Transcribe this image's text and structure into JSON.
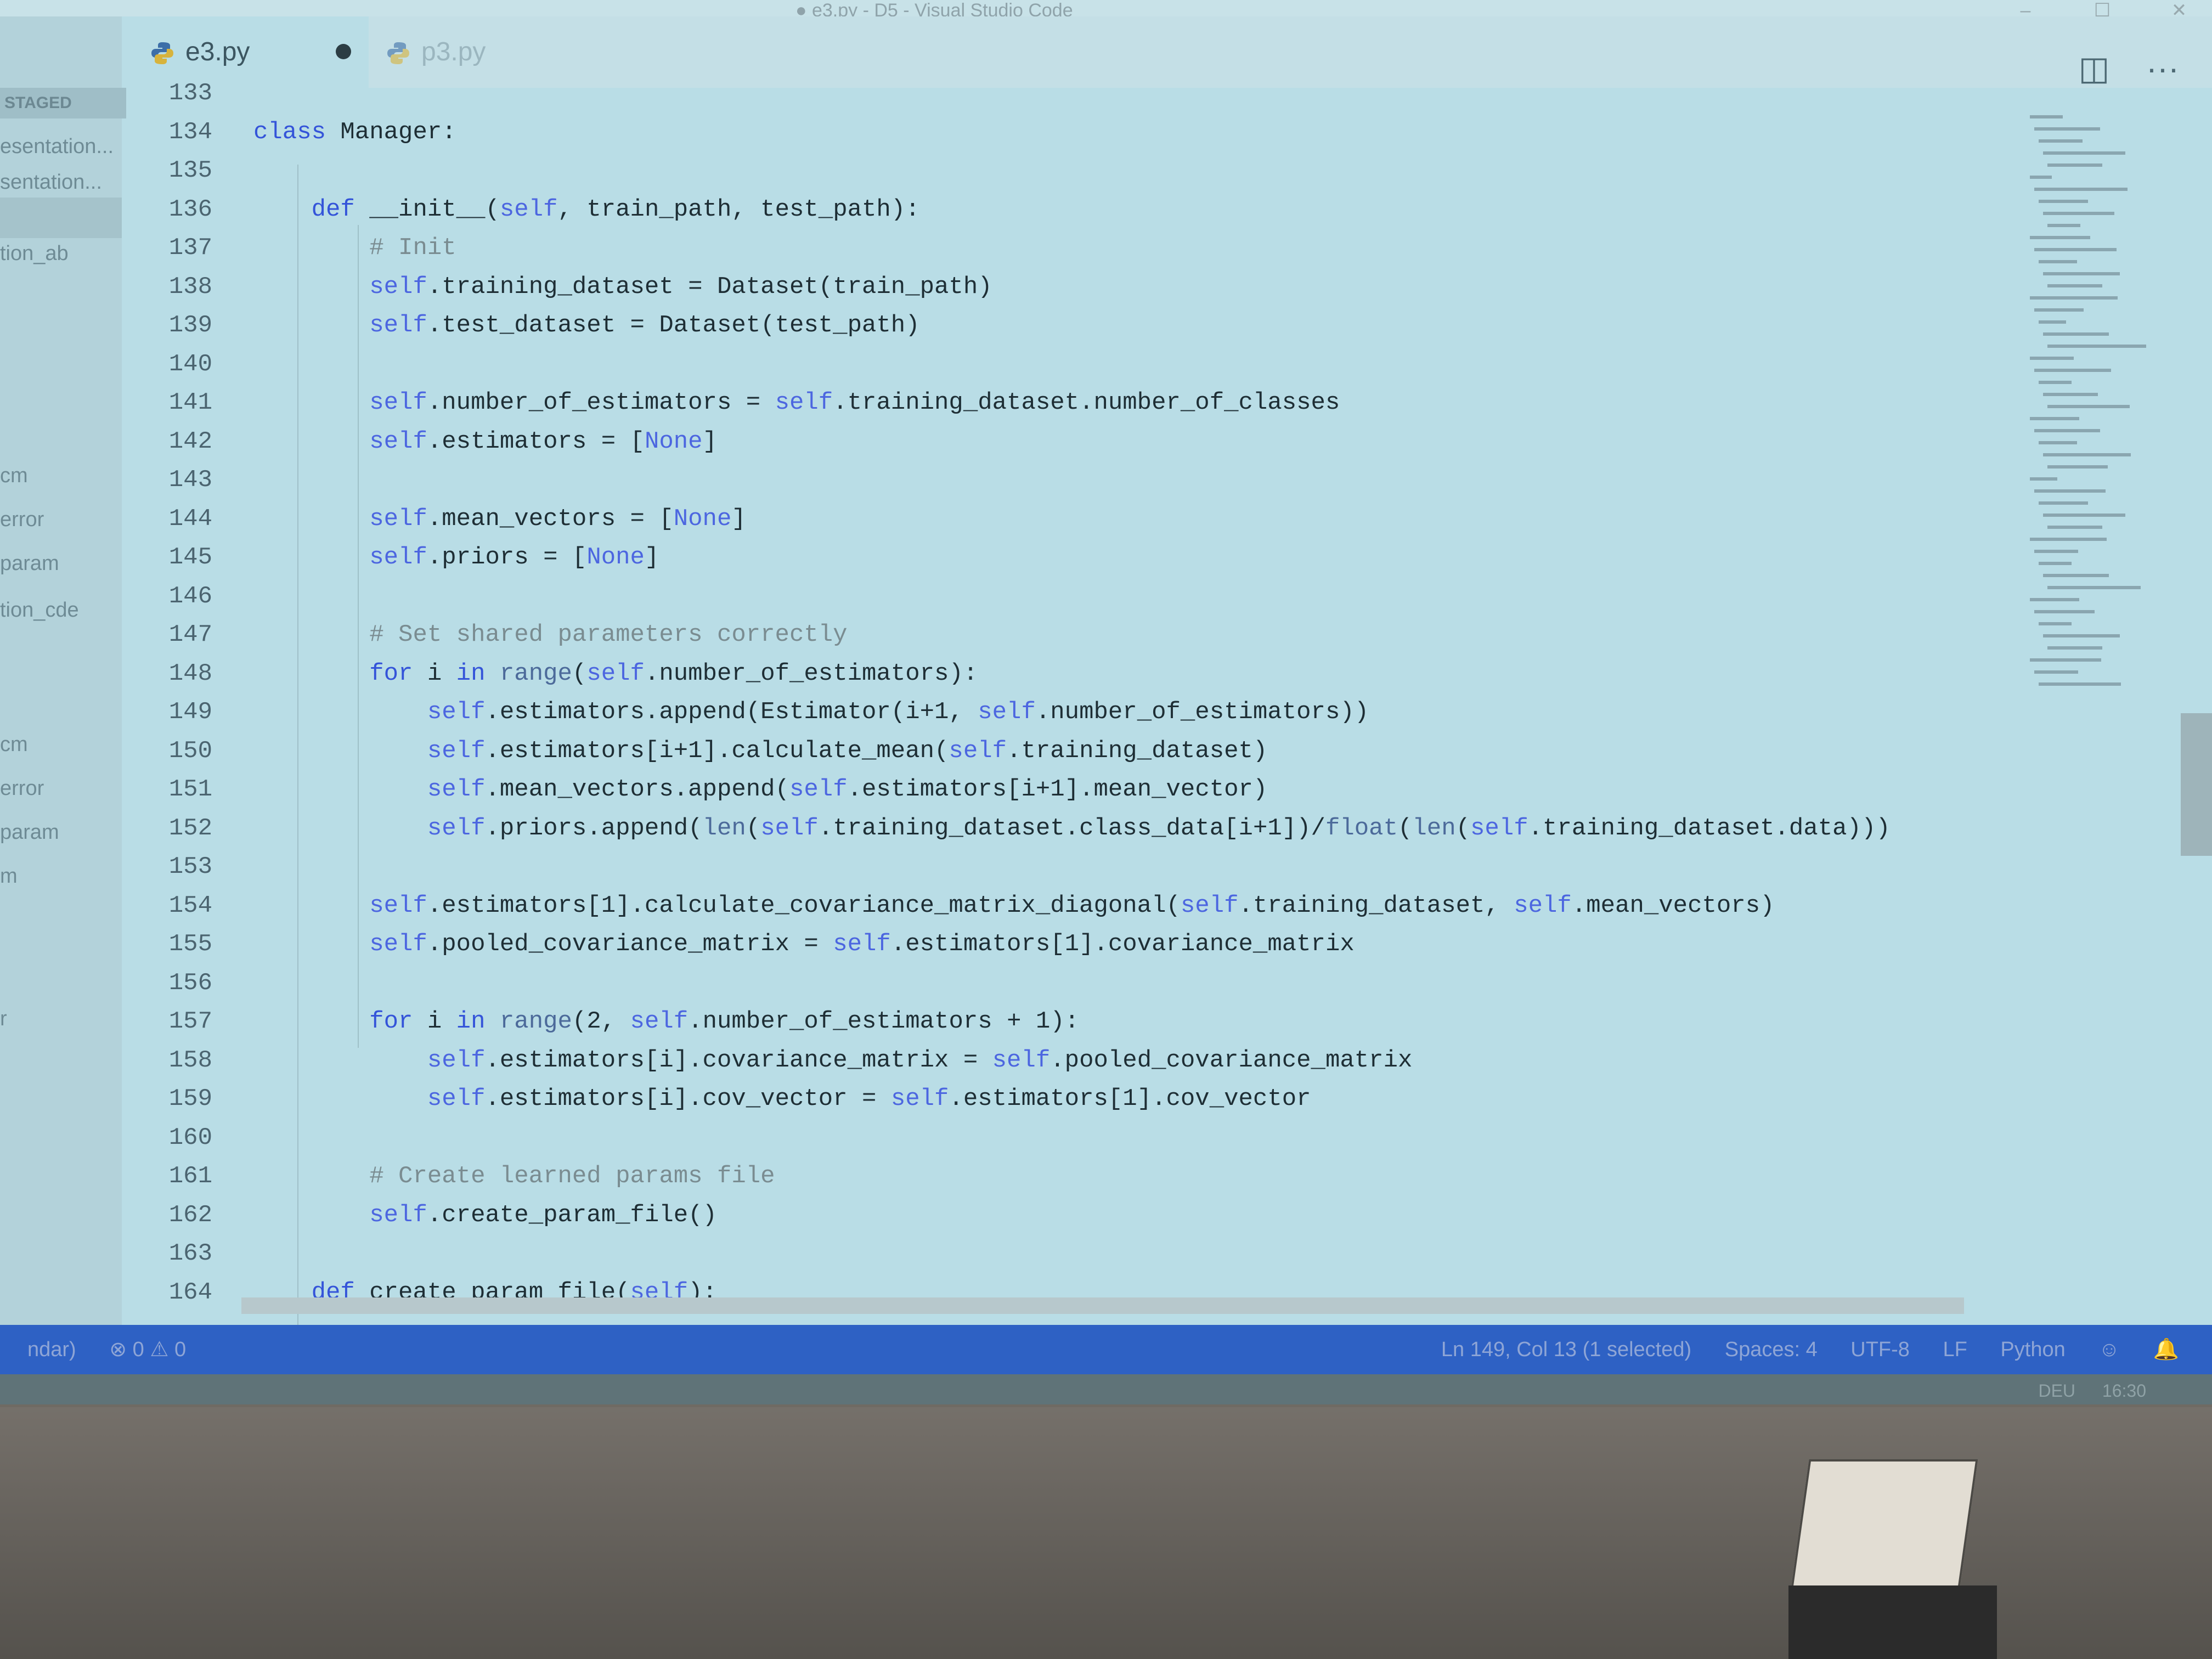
{
  "window": {
    "title": "● e3.py - D5 - Visual Studio Code",
    "controls": [
      "–",
      "☐",
      "✕"
    ]
  },
  "tabs": [
    {
      "label": "e3.py",
      "modified": true
    },
    {
      "label": "p3.py"
    }
  ],
  "explorer": {
    "header": "STAGED",
    "items": [
      "esentation...",
      "sentation...",
      "",
      "tion_ab",
      "",
      "cm",
      "error",
      "param",
      "tion_cde",
      "",
      "cm",
      "error",
      "param",
      "m",
      "",
      "r"
    ]
  },
  "editor": {
    "lines": [
      {
        "n": "133",
        "t": ""
      },
      {
        "n": "134",
        "t": "class Manager:"
      },
      {
        "n": "135",
        "t": ""
      },
      {
        "n": "136",
        "t": "    def __init__(self, train_path, test_path):"
      },
      {
        "n": "137",
        "t": "        # Init"
      },
      {
        "n": "138",
        "t": "        self.training_dataset = Dataset(train_path)"
      },
      {
        "n": "139",
        "t": "        self.test_dataset = Dataset(test_path)"
      },
      {
        "n": "140",
        "t": ""
      },
      {
        "n": "141",
        "t": "        self.number_of_estimators = self.training_dataset.number_of_classes"
      },
      {
        "n": "142",
        "t": "        self.estimators = [None]"
      },
      {
        "n": "143",
        "t": ""
      },
      {
        "n": "144",
        "t": "        self.mean_vectors = [None]"
      },
      {
        "n": "145",
        "t": "        self.priors = [None]"
      },
      {
        "n": "146",
        "t": ""
      },
      {
        "n": "147",
        "t": "        # Set shared parameters correctly"
      },
      {
        "n": "148",
        "t": "        for i in range(self.number_of_estimators):"
      },
      {
        "n": "149",
        "t": "            self.estimators.append(Estimator(i+1, self.number_of_estimators))"
      },
      {
        "n": "150",
        "t": "            self.estimators[i+1].calculate_mean(self.training_dataset)"
      },
      {
        "n": "151",
        "t": "            self.mean_vectors.append(self.estimators[i+1].mean_vector)"
      },
      {
        "n": "152",
        "t": "            self.priors.append(len(self.training_dataset.class_data[i+1])/float(len(self.training_dataset.data)))"
      },
      {
        "n": "153",
        "t": ""
      },
      {
        "n": "154",
        "t": "        self.estimators[1].calculate_covariance_matrix_diagonal(self.training_dataset, self.mean_vectors)"
      },
      {
        "n": "155",
        "t": "        self.pooled_covariance_matrix = self.estimators[1].covariance_matrix"
      },
      {
        "n": "156",
        "t": ""
      },
      {
        "n": "157",
        "t": "        for i in range(2, self.number_of_estimators + 1):"
      },
      {
        "n": "158",
        "t": "            self.estimators[i].covariance_matrix = self.pooled_covariance_matrix"
      },
      {
        "n": "159",
        "t": "            self.estimators[i].cov_vector = self.estimators[1].cov_vector"
      },
      {
        "n": "160",
        "t": ""
      },
      {
        "n": "161",
        "t": "        # Create learned params file"
      },
      {
        "n": "162",
        "t": "        self.create_param_file()"
      },
      {
        "n": "163",
        "t": ""
      },
      {
        "n": "164",
        "t": "    def create_param_file(self):"
      }
    ]
  },
  "status_bar": {
    "left": [
      "ndar)",
      "⊗ 0 ⚠ 0"
    ],
    "right": [
      "Ln 149, Col 13 (1 selected)",
      "Spaces: 4",
      "UTF-8",
      "LF",
      "Python",
      "☺",
      "🔔"
    ]
  },
  "taskbar": {
    "tray": [
      "DEU",
      "16:30"
    ]
  },
  "colors": {
    "editor_bg": "#b9dde6",
    "keyword": "#3454d9",
    "status_bar": "#2e61c4"
  },
  "icons": [
    "python-file-icon",
    "split-editor-icon",
    "more-actions-icon"
  ]
}
